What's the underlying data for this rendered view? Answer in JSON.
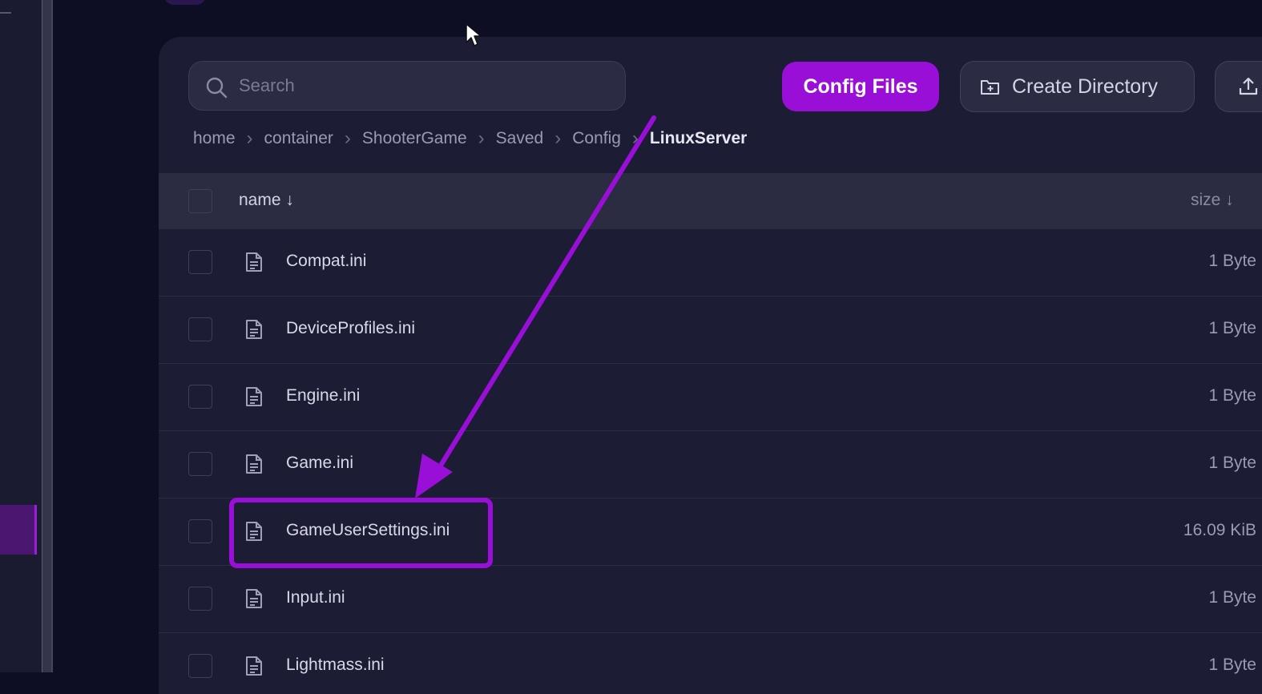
{
  "search": {
    "placeholder": "Search"
  },
  "toolbar": {
    "config_files_label": "Config Files",
    "create_directory_label": "Create Directory",
    "upload_icon": "upload-icon",
    "create_directory_icon": "folder-plus-icon"
  },
  "breadcrumb": [
    "home",
    "container",
    "ShooterGame",
    "Saved",
    "Config",
    "LinuxServer"
  ],
  "table": {
    "columns": {
      "name": "name ↓",
      "size": "size ↓"
    },
    "rows": [
      {
        "name": "Compat.ini",
        "size": "1 Byte"
      },
      {
        "name": "DeviceProfiles.ini",
        "size": "1 Byte"
      },
      {
        "name": "Engine.ini",
        "size": "1 Byte"
      },
      {
        "name": "Game.ini",
        "size": "1 Byte"
      },
      {
        "name": "GameUserSettings.ini",
        "size": "16.09 KiB"
      },
      {
        "name": "Input.ini",
        "size": "1 Byte"
      },
      {
        "name": "Lightmass.ini",
        "size": "1 Byte"
      }
    ]
  },
  "annotation": {
    "highlighted_row": "GameUserSettings.ini",
    "color": "#9a0fd8"
  },
  "colors": {
    "accent": "#9a0fd8",
    "background": "#0d0e24",
    "panel": "#1c1c34"
  }
}
